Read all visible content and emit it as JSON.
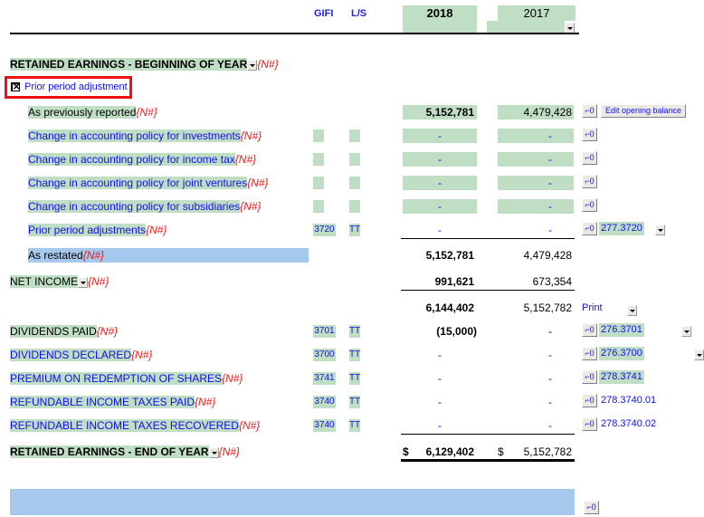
{
  "header": {
    "gifi": "GIFI",
    "ls": "L/S",
    "year1": "2018",
    "year2": "2017"
  },
  "re_begin": {
    "label": "RETAINED EARNINGS - BEGINNING OF YEAR",
    "nref": "{N#}"
  },
  "prior_period_checkbox": {
    "label": "Prior period adjustment",
    "checked": true,
    "glyph": "✕"
  },
  "rows": {
    "as_previously_reported": {
      "label": "As previously reported",
      "nref": "{N#}",
      "y2018": "5,152,781",
      "y2017": "4,479,428",
      "button": "Edit opening balance"
    },
    "change_investments": {
      "label": "Change in accounting policy for investments",
      "nref": "{N#}",
      "y2018": "-",
      "y2017": "-"
    },
    "change_income_tax": {
      "label": "Change in accounting policy for income tax",
      "nref": "{N#}",
      "y2018": "-",
      "y2017": "-"
    },
    "change_joint_ventures": {
      "label": "Change in accounting policy for joint ventures",
      "nref": "{N#}",
      "y2018": "-",
      "y2017": "-"
    },
    "change_subsidiaries": {
      "label": "Change in accounting policy for subsidiaries",
      "nref": "{N#}",
      "y2018": "-",
      "y2017": "-"
    },
    "prior_period_adjustments": {
      "label": "Prior period adjustments",
      "nref": "{N#}",
      "gifi": "3720",
      "ls": "TT",
      "y2018": "-",
      "y2017": "-",
      "ref": "277.3720"
    },
    "as_restated": {
      "label": "As restated",
      "nref": "{N#}",
      "y2018": "5,152,781",
      "y2017": "4,479,428"
    },
    "net_income": {
      "label": "NET INCOME",
      "nref": "{N#}",
      "y2018": "991,621",
      "y2017": "673,354"
    },
    "subtotal": {
      "y2018": "6,144,402",
      "y2017": "5,152,782",
      "print": "Print"
    },
    "dividends_paid": {
      "label": "DIVIDENDS PAID",
      "nref": "{N#}",
      "gifi": "3701",
      "ls": "TT",
      "y2018": "(15,000)",
      "y2017": "-",
      "ref": "276.3701"
    },
    "dividends_declared": {
      "label": "DIVIDENDS DECLARED",
      "nref": "{N#}",
      "gifi": "3700",
      "ls": "TT",
      "y2018": "-",
      "y2017": "-",
      "ref": "276.3700"
    },
    "premium_redemption": {
      "label": "PREMIUM ON REDEMPTION OF SHARES",
      "nref": "{N#}",
      "gifi": "3741",
      "ls": "TT",
      "y2018": "-",
      "y2017": "-",
      "ref": "278.3741"
    },
    "rit_paid": {
      "label": "REFUNDABLE INCOME TAXES PAID",
      "nref": "{N#}",
      "gifi": "3740",
      "ls": "TT",
      "y2018": "-",
      "y2017": "-",
      "ref": "278.3740.01"
    },
    "rit_recovered": {
      "label": "REFUNDABLE INCOME TAXES RECOVERED",
      "nref": "{N#}",
      "gifi": "3740",
      "ls": "TT",
      "y2018": "-",
      "y2017": "-",
      "ref": "278.3740.02"
    }
  },
  "re_end": {
    "label": "RETAINED EARNINGS - END OF YEAR",
    "nref": "{N#}",
    "currency": "$",
    "y2018": "6,129,402",
    "y2017": "5,152,782"
  },
  "icons": {
    "small_button_glyph": "⌐0"
  },
  "colors": {
    "input_green": "#c0dec4",
    "note_blue": "#a6c8ec",
    "link_blue": "#1010ee",
    "nref_red": "#ee1a1a",
    "highlight_red": "#ee1111"
  }
}
